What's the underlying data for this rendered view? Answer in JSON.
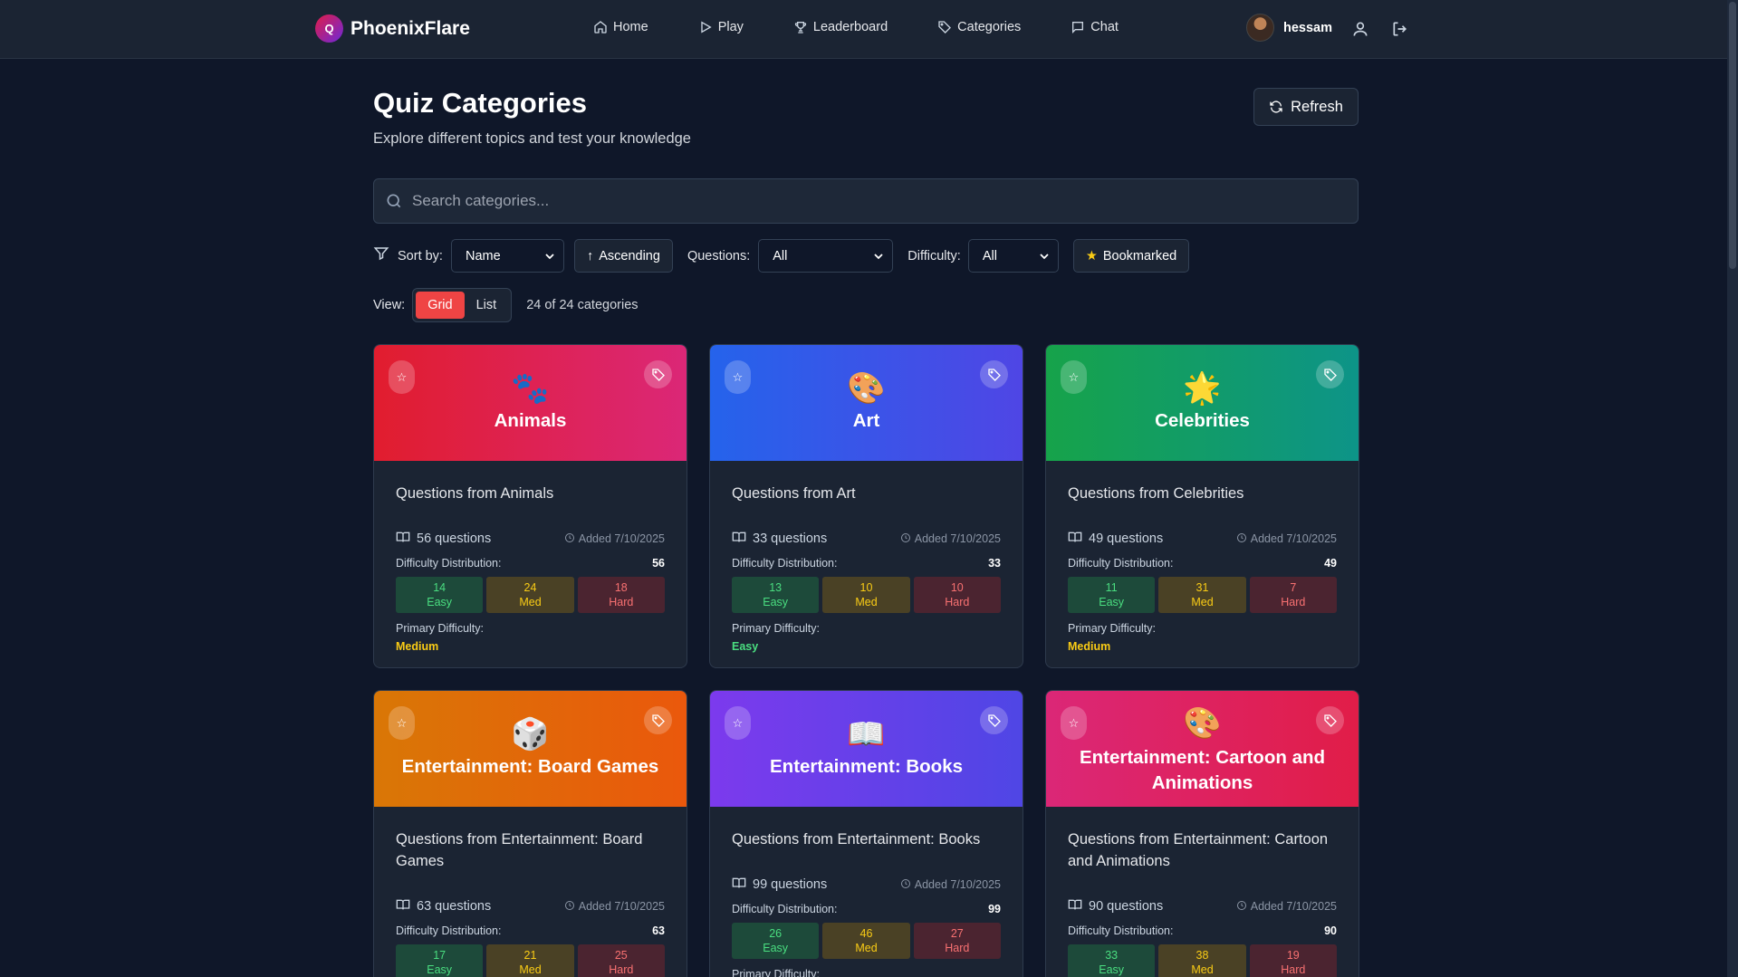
{
  "nav": {
    "brand_letter": "Q",
    "brand": "PhoenixFlare",
    "links": [
      "Home",
      "Play",
      "Leaderboard",
      "Categories",
      "Chat"
    ],
    "username": "hessam"
  },
  "header": {
    "title": "Quiz Categories",
    "subtitle": "Explore different topics and test your knowledge",
    "refresh": "Refresh"
  },
  "search": {
    "placeholder": "Search categories..."
  },
  "filters": {
    "sort_label": "Sort by:",
    "sort_value": "Name",
    "order": "Ascending",
    "questions_label": "Questions:",
    "questions_value": "All",
    "difficulty_label": "Difficulty:",
    "difficulty_value": "All",
    "bookmarked": "Bookmarked"
  },
  "view": {
    "label": "View:",
    "grid": "Grid",
    "list": "List",
    "count": "24 of 24 categories"
  },
  "labels": {
    "dist": "Difficulty Distribution:",
    "primary": "Primary Difficulty:",
    "easy": "Easy",
    "med": "Med",
    "hard": "Hard"
  },
  "cards": [
    {
      "name": "Animals",
      "emoji": "🐾",
      "gradient": [
        "#e11d2e",
        "#db2777"
      ],
      "desc": "Questions from Animals",
      "questions": "56 questions",
      "added": "Added 7/10/2025",
      "total": "56",
      "easy": "14",
      "med": "24",
      "hard": "18",
      "primary": "Medium"
    },
    {
      "name": "Art",
      "emoji": "🎨",
      "gradient": [
        "#2563eb",
        "#4f46e5"
      ],
      "desc": "Questions from Art",
      "questions": "33 questions",
      "added": "Added 7/10/2025",
      "total": "33",
      "easy": "13",
      "med": "10",
      "hard": "10",
      "primary": "Easy"
    },
    {
      "name": "Celebrities",
      "emoji": "🌟",
      "gradient": [
        "#16a34a",
        "#0d9488"
      ],
      "desc": "Questions from Celebrities",
      "questions": "49 questions",
      "added": "Added 7/10/2025",
      "total": "49",
      "easy": "11",
      "med": "31",
      "hard": "7",
      "primary": "Medium"
    },
    {
      "name": "Entertainment: Board Games",
      "emoji": "🎲",
      "gradient": [
        "#d97706",
        "#ea580c"
      ],
      "desc": "Questions from Entertainment: Board Games",
      "questions": "63 questions",
      "added": "Added 7/10/2025",
      "total": "63",
      "easy": "17",
      "med": "21",
      "hard": "25",
      "primary": ""
    },
    {
      "name": "Entertainment: Books",
      "emoji": "📖",
      "gradient": [
        "#7c3aed",
        "#4f46e5"
      ],
      "desc": "Questions from Entertainment: Books",
      "questions": "99 questions",
      "added": "Added 7/10/2025",
      "total": "99",
      "easy": "26",
      "med": "46",
      "hard": "27",
      "primary": ""
    },
    {
      "name": "Entertainment: Cartoon and Animations",
      "emoji": "🎨",
      "gradient": [
        "#db2777",
        "#e11d48"
      ],
      "desc": "Questions from Entertainment: Cartoon and Animations",
      "questions": "90 questions",
      "added": "Added 7/10/2025",
      "total": "90",
      "easy": "33",
      "med": "38",
      "hard": "19",
      "primary": ""
    }
  ]
}
